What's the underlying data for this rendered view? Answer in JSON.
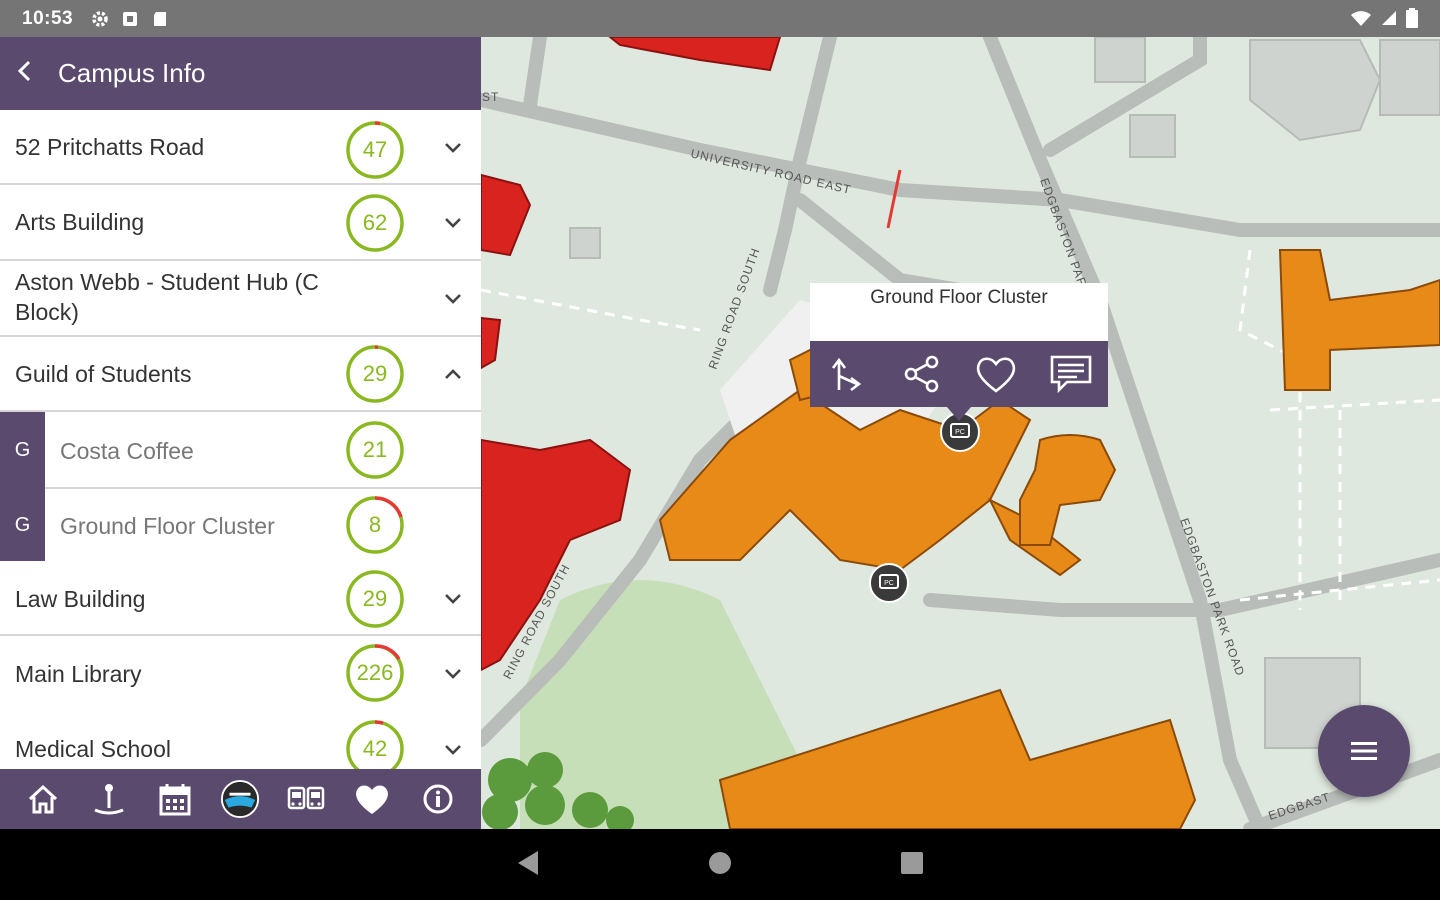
{
  "status": {
    "time": "10:53"
  },
  "header": {
    "back_icon": "arrow-back-icon",
    "title": "Campus Info"
  },
  "colors": {
    "purple": "#5a4a6e",
    "green": "#8ab821",
    "red": "#e53935",
    "orange": "#e88a18",
    "building_red": "#d9231f"
  },
  "list": {
    "items": [
      {
        "name": "52 Pritchatts Road",
        "count": "47",
        "fraction": 0.97,
        "expanded": false
      },
      {
        "name": "Arts Building",
        "count": "62",
        "fraction": 1.0,
        "expanded": false
      },
      {
        "name": "Aston Webb - Student Hub (C Block)",
        "count": "",
        "expanded": false
      },
      {
        "name": "Guild of Students",
        "count": "29",
        "fraction": 0.98,
        "expanded": true
      },
      {
        "name": "Costa Coffee",
        "count": "21",
        "fraction": 1.0,
        "group": "G"
      },
      {
        "name": "Ground Floor Cluster",
        "count": "8",
        "fraction": 0.8,
        "group": "G"
      },
      {
        "name": "Law Building",
        "count": "29",
        "fraction": 1.0,
        "expanded": false
      },
      {
        "name": "Main Library",
        "count": "226",
        "fraction": 0.88,
        "expanded": false
      },
      {
        "name": "Medical School",
        "count": "42",
        "fraction": 0.95,
        "expanded": false
      }
    ]
  },
  "bottom_nav": [
    "home-icon",
    "pin-icon",
    "calendar-icon",
    "logo-icon",
    "bus-icon",
    "heart-icon",
    "info-icon"
  ],
  "map": {
    "street_labels": [
      "UNIVERSITY ROAD EAST",
      "RING ROAD SOUTH",
      "RING ROAD SOUTH",
      "EDGBASTON PARK ROAD",
      "EDGBASTON PARK ROAD",
      "EDGBAST",
      "ST"
    ],
    "popup": {
      "title": "Ground Floor Cluster",
      "actions": [
        "directions-icon",
        "share-icon",
        "favorite-icon",
        "comment-icon"
      ]
    },
    "marker_label": "PC",
    "fab_icon": "menu-icon"
  },
  "system_nav": [
    "back-icon",
    "home-icon",
    "recents-icon"
  ]
}
